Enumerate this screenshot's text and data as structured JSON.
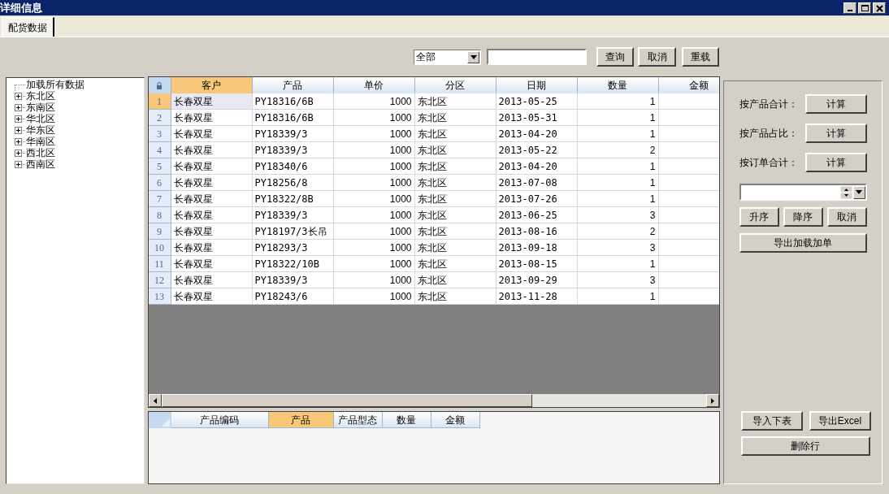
{
  "window": {
    "title": "详细信息"
  },
  "tabs": [
    {
      "label": "配货数据",
      "selected": true
    }
  ],
  "filter": {
    "dropdown_value": "全部",
    "buttons": [
      "查询",
      "取消",
      "重载"
    ]
  },
  "tree": [
    {
      "label": "加载所有数据",
      "kind": "leaf"
    },
    {
      "label": "东北区",
      "kind": "node",
      "expanded": false
    },
    {
      "label": "东南区",
      "kind": "node",
      "expanded": false
    },
    {
      "label": "华北区",
      "kind": "node",
      "expanded": false
    },
    {
      "label": "华东区",
      "kind": "node",
      "expanded": false
    },
    {
      "label": "华南区",
      "kind": "node",
      "expanded": false
    },
    {
      "label": "西北区",
      "kind": "node",
      "expanded": false
    },
    {
      "label": "西南区",
      "kind": "node",
      "expanded": false
    }
  ],
  "table": {
    "columns": [
      {
        "label": "客户",
        "selected": true
      },
      {
        "label": "产品",
        "selected": false
      },
      {
        "label": "单价",
        "selected": false
      },
      {
        "label": "分区",
        "selected": false
      },
      {
        "label": "日期",
        "selected": false
      },
      {
        "label": "数量",
        "selected": false
      },
      {
        "label": "金额",
        "selected": false
      }
    ],
    "rows": [
      {
        "number": "1",
        "selected": true,
        "cells": [
          "长春双星",
          "PY18316/6B",
          "1000",
          "东北区",
          "2013-05-25",
          "1"
        ]
      },
      {
        "number": "2",
        "selected": false,
        "cells": [
          "长春双星",
          "PY18316/6B",
          "1000",
          "东北区",
          "2013-05-31",
          "1"
        ]
      },
      {
        "number": "3",
        "selected": false,
        "cells": [
          "长春双星",
          "PY18339/3",
          "1000",
          "东北区",
          "2013-04-20",
          "1"
        ]
      },
      {
        "number": "4",
        "selected": false,
        "cells": [
          "长春双星",
          "PY18339/3",
          "1000",
          "东北区",
          "2013-05-22",
          "2"
        ]
      },
      {
        "number": "5",
        "selected": false,
        "cells": [
          "长春双星",
          "PY18340/6",
          "1000",
          "东北区",
          "2013-04-20",
          "1"
        ]
      },
      {
        "number": "6",
        "selected": false,
        "cells": [
          "长春双星",
          "PY18256/8",
          "1000",
          "东北区",
          "2013-07-08",
          "1"
        ]
      },
      {
        "number": "7",
        "selected": false,
        "cells": [
          "长春双星",
          "PY18322/8B",
          "1000",
          "东北区",
          "2013-07-26",
          "1"
        ]
      },
      {
        "number": "8",
        "selected": false,
        "cells": [
          "长春双星",
          "PY18339/3",
          "1000",
          "东北区",
          "2013-06-25",
          "3"
        ]
      },
      {
        "number": "9",
        "selected": false,
        "cells": [
          "长春双星",
          "PY18197/3长吊",
          "1000",
          "东北区",
          "2013-08-16",
          "2"
        ]
      },
      {
        "number": "10",
        "selected": false,
        "cells": [
          "长春双星",
          "PY18293/3",
          "1000",
          "东北区",
          "2013-09-18",
          "3"
        ]
      },
      {
        "number": "11",
        "selected": false,
        "cells": [
          "长春双星",
          "PY18322/10B",
          "1000",
          "东北区",
          "2013-08-15",
          "1"
        ]
      },
      {
        "number": "12",
        "selected": false,
        "cells": [
          "长春双星",
          "PY18339/3",
          "1000",
          "东北区",
          "2013-09-29",
          "3"
        ]
      },
      {
        "number": "13",
        "selected": false,
        "cells": [
          "长春双星",
          "PY18243/6",
          "1000",
          "东北区",
          "2013-11-28",
          "1"
        ]
      }
    ]
  },
  "detail_table": {
    "columns": [
      {
        "label": "产品编码",
        "selected": false
      },
      {
        "label": "产品",
        "selected": true
      },
      {
        "label": "产品型态",
        "selected": false
      },
      {
        "label": "数量",
        "selected": false
      },
      {
        "label": "金额",
        "selected": false
      }
    ]
  },
  "side_panel": {
    "calculations": [
      {
        "label": "按产品合计：",
        "button": "计算"
      },
      {
        "label": "按产品占比：",
        "button": "计算"
      },
      {
        "label": "按订单合计：",
        "button": "计算"
      }
    ],
    "sort_buttons": [
      "升序",
      "降序",
      "取消"
    ],
    "export_button": "导出加载加单",
    "bottom_buttons": [
      "导入下表",
      "导出Excel"
    ],
    "delete_button": "删除行"
  }
}
